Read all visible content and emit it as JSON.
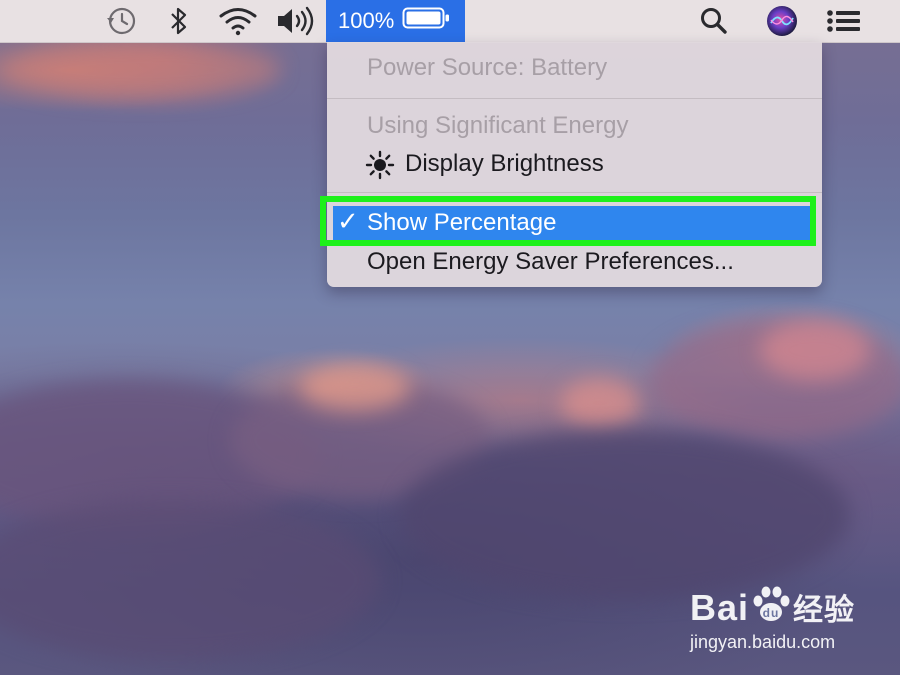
{
  "menubar": {
    "icons": [
      "time-machine-icon",
      "bluetooth-icon",
      "wifi-icon",
      "volume-icon",
      "spotlight-search-icon",
      "siri-icon",
      "notification-center-icon"
    ],
    "battery": {
      "percentage_label": "100%",
      "level": 1.0,
      "icon": "battery-icon",
      "highlight_color": "#2a6fe6"
    }
  },
  "battery_menu": {
    "power_source": "Power Source: Battery",
    "section_heading": "Using Significant Energy",
    "app_item": {
      "icon": "sun-icon",
      "label": "Display Brightness"
    },
    "show_percentage": {
      "check": "✓",
      "label": "Show Percentage",
      "checked": true,
      "highlighted": true
    },
    "preferences": "Open Energy Saver Preferences...",
    "selection_color": "#2f86ee",
    "annotation_color": "#1ef01b"
  },
  "watermark": {
    "main_text": "Bai",
    "main_text_end": "经验",
    "paw_icon": "baidu-paw-icon",
    "url": "jingyan.baidu.com"
  }
}
